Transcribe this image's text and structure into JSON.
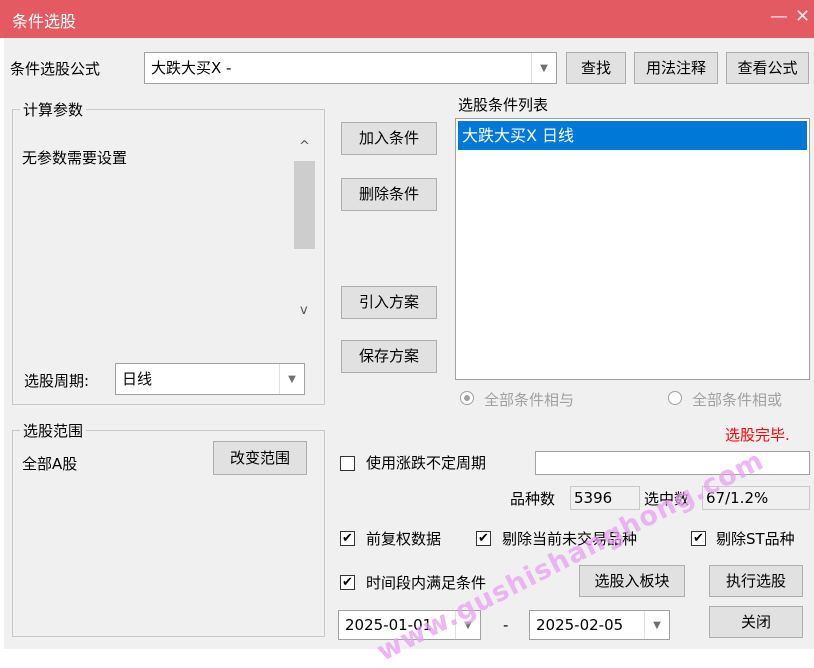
{
  "window": {
    "title": "条件选股",
    "minimize_glyph": "—",
    "close_glyph": "✕"
  },
  "formula": {
    "label": "条件选股公式",
    "value": "大跌大买X  -",
    "find": "查找",
    "usage": "用法注释",
    "view": "查看公式"
  },
  "params": {
    "group_label": "计算参数",
    "text": "无参数需要设置",
    "scroll_up": "^",
    "scroll_down": "v"
  },
  "period": {
    "label": "选股周期:",
    "value": "日线"
  },
  "scope": {
    "group_label": "选股范围",
    "value": "全部A股",
    "change": "改变范围"
  },
  "actions": {
    "add": "加入条件",
    "delete": "删除条件",
    "import": "引入方案",
    "save": "保存方案"
  },
  "conditions": {
    "title": "选股条件列表",
    "items": [
      "大跌大买X  日线"
    ]
  },
  "logic": {
    "and": "全部条件相与",
    "or": "全部条件相或"
  },
  "status": {
    "done": "选股完毕.",
    "color": "#ff0000"
  },
  "irregular_period": {
    "label": "使用涨跌不定周期",
    "checked": false,
    "value": ""
  },
  "stats": {
    "count_label": "品种数",
    "count_value": "5396",
    "selected_label": "选中数",
    "selected_value": "67/1.2%"
  },
  "options": {
    "restored": {
      "label": "前复权数据",
      "checked": true
    },
    "exclude_untraded": {
      "label": "剔除当前未交易品种",
      "checked": true
    },
    "exclude_st": {
      "label": "剔除ST品种",
      "checked": true
    },
    "time_range": {
      "label": "时间段内满足条件",
      "checked": true
    }
  },
  "buttons": {
    "to_block": "选股入板块",
    "execute": "执行选股",
    "close": "关闭"
  },
  "dates": {
    "from": "2025-01-01",
    "separator": "-",
    "to": "2025-02-05"
  },
  "watermark": {
    "text": "www.gushishanghong.com"
  },
  "icons": {
    "check": "checkmark-icon",
    "dropdown": "chevron-down-icon",
    "scroll_up": "chevron-up-icon",
    "scroll_down": "chevron-down-icon"
  }
}
